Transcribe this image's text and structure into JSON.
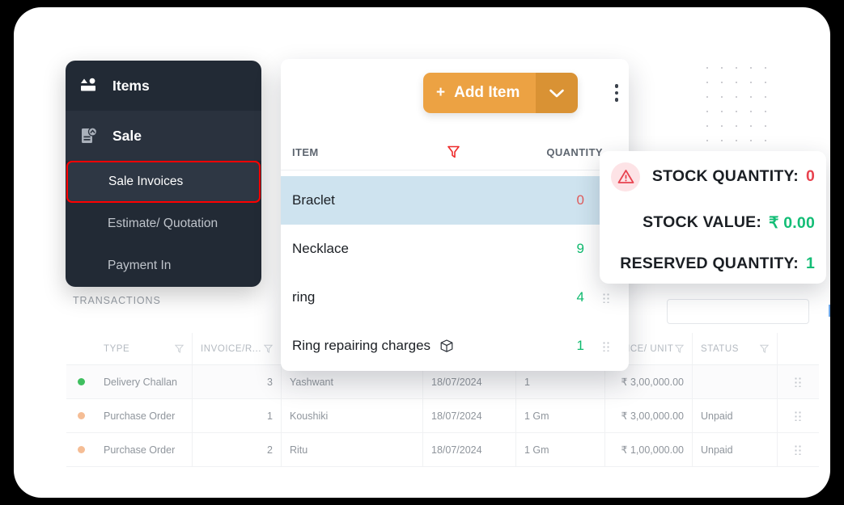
{
  "sidebar": {
    "items": [
      {
        "label": "Items",
        "icon": "items-icon",
        "type": "main"
      },
      {
        "label": "Sale",
        "icon": "sale-doc-icon",
        "type": "main",
        "active": true
      },
      {
        "label": "Sale Invoices",
        "type": "sub",
        "selected": true
      },
      {
        "label": "Estimate/ Quotation",
        "type": "sub"
      },
      {
        "label": "Payment In",
        "type": "sub"
      }
    ]
  },
  "items_panel": {
    "add_item_label": "Add Item",
    "add_item_plus": "+",
    "columns": {
      "item": "ITEM",
      "quantity": "QUANTITY"
    },
    "rows": [
      {
        "name": "Braclet",
        "qty": "0",
        "qty_state": "zero",
        "selected": true,
        "has_grip": false,
        "has_box_icon": false
      },
      {
        "name": "Necklace",
        "qty": "9",
        "qty_state": "positive",
        "selected": false,
        "has_grip": false,
        "has_box_icon": false
      },
      {
        "name": "ring",
        "qty": "4",
        "qty_state": "positive",
        "selected": false,
        "has_grip": true,
        "has_box_icon": false
      },
      {
        "name": "Ring repairing charges",
        "qty": "1",
        "qty_state": "positive",
        "selected": false,
        "has_grip": true,
        "has_box_icon": true
      }
    ]
  },
  "stock_tooltip": {
    "stock_quantity_label": "STOCK QUANTITY:",
    "stock_quantity_value": "0",
    "stock_value_label": "STOCK VALUE:",
    "stock_value_value": "₹ 0.00",
    "reserved_quantity_label": "RESERVED QUANTITY:",
    "reserved_quantity_value": "1"
  },
  "transactions": {
    "section_label": "TRANSACTIONS",
    "search_value": "",
    "search_placeholder": "",
    "columns": {
      "type": "TYPE",
      "invoice": "INVOICE/R...",
      "price_unit": "PRICE/ UNIT",
      "status": "STATUS"
    },
    "rows": [
      {
        "dot_color": "#3fbf5f",
        "type": "Delivery Challan",
        "invoice": "3",
        "name": "Yashwant",
        "date": "18/07/2024",
        "qty": "1",
        "price": "₹ 3,00,000.00",
        "status": ""
      },
      {
        "dot_color": "#f5bd95",
        "type": "Purchase Order",
        "invoice": "1",
        "name": "Koushiki",
        "date": "18/07/2024",
        "qty": "1 Gm",
        "price": "₹ 3,00,000.00",
        "status": "Unpaid"
      },
      {
        "dot_color": "#f5bd95",
        "type": "Purchase Order",
        "invoice": "2",
        "name": "Ritu",
        "date": "18/07/2024",
        "qty": "1 Gm",
        "price": "₹ 1,00,000.00",
        "status": "Unpaid"
      }
    ]
  },
  "colors": {
    "accent_orange": "#eca243",
    "accent_orange_dark": "#d99234",
    "sidebar_bg": "#222a35",
    "selected_row": "#cee3ef",
    "highlight_border": "#ff0000",
    "positive_green": "#0fba6e",
    "negative_red": "#e05c5c"
  }
}
